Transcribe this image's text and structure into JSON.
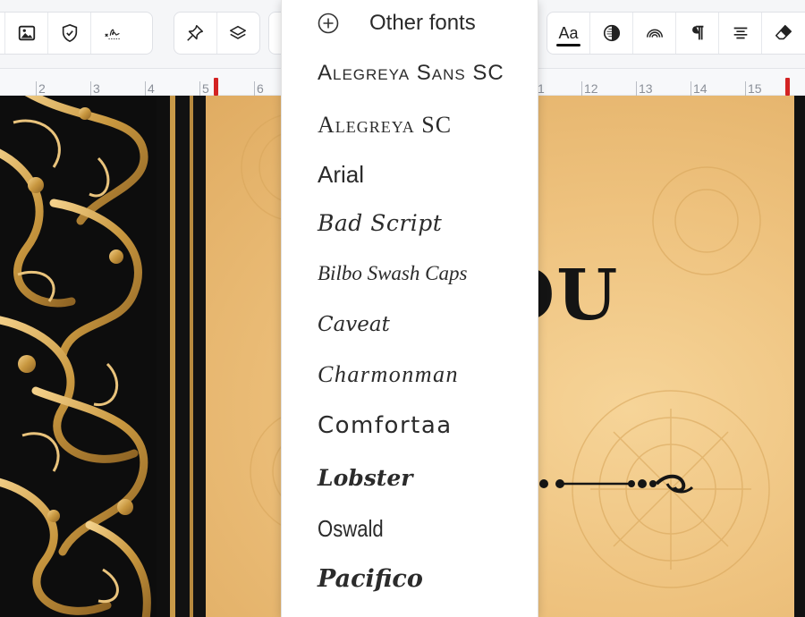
{
  "toolbar": {
    "left_group_1": [
      "image-icon",
      "shield-check-icon",
      "signature-icon"
    ],
    "left_group_2": [
      "pin-icon",
      "layers-icon"
    ],
    "right_group": [
      "text-style-icon",
      "contrast-icon",
      "curve-text-icon",
      "paragraph-icon",
      "align-center-icon",
      "eraser-icon"
    ],
    "text_style_label": "Aa"
  },
  "ruler": {
    "left_ticks": [
      "2",
      "3",
      "4",
      "5",
      "6"
    ],
    "right_ticks": [
      "1",
      "12",
      "13",
      "14",
      "15"
    ],
    "marker_color": "#d32323"
  },
  "canvas": {
    "card_text": "E YOU",
    "accent_gold": "#c99a49",
    "card_bg": "#eec27e"
  },
  "font_menu": {
    "other_fonts_label": "Other fonts",
    "fonts": [
      "Alegreya Sans SC",
      "Alegreya SC",
      "Arial",
      "Bad Script",
      "Bilbo Swash Caps",
      "Caveat",
      "Charmonman",
      "Comfortaa",
      "Lobster",
      "Oswald",
      "Pacifico"
    ]
  }
}
